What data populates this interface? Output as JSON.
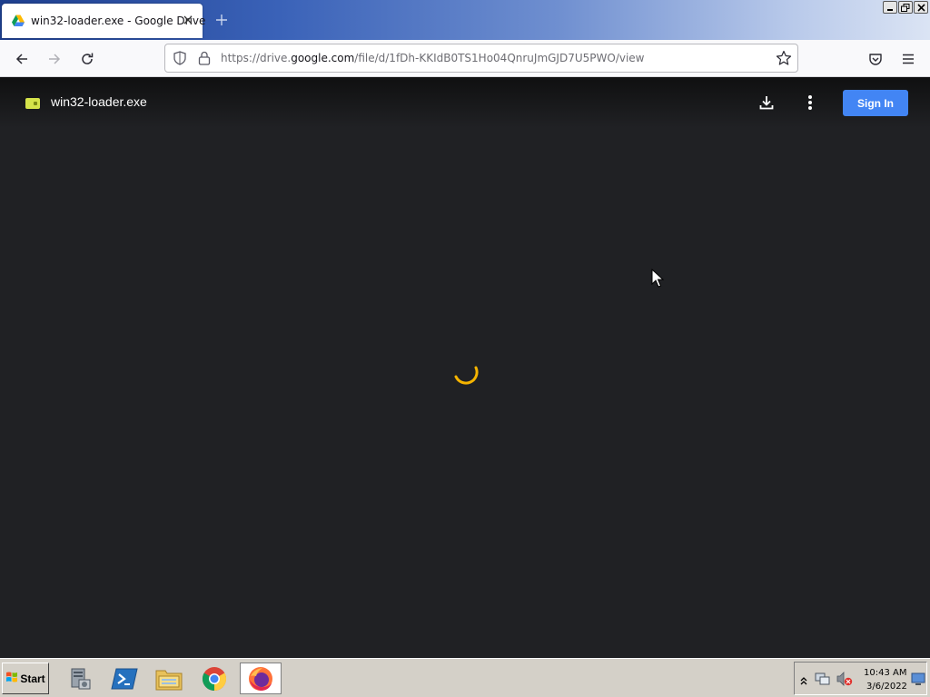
{
  "browser": {
    "tab": {
      "title": "win32-loader.exe - Google Drive"
    },
    "url": {
      "prefix": "https://drive.",
      "domain": "google.com",
      "path": "/file/d/1fDh-KKIdB0TS1Ho04QnruJmGJD7U5PWO/view"
    }
  },
  "viewer": {
    "file_name": "win32-loader.exe",
    "sign_in_label": "Sign In",
    "state": "loading"
  },
  "taskbar": {
    "start_label": "Start",
    "clock_time": "10:43 AM",
    "clock_date": "3/6/2022"
  },
  "colors": {
    "viewer_background": "#202124",
    "sign_in_button": "#4285f4",
    "spinner": "#f5b400",
    "file_icon": "#d5e34a"
  },
  "icons": [
    "google-drive-favicon-icon",
    "close-icon",
    "plus-icon",
    "back-arrow-icon",
    "forward-arrow-icon",
    "reload-icon",
    "shield-icon",
    "lock-icon",
    "star-icon",
    "pocket-icon",
    "hamburger-menu-icon",
    "download-icon",
    "more-vertical-icon",
    "loading-spinner",
    "windows-logo-icon",
    "server-manager-icon",
    "powershell-icon",
    "file-explorer-icon",
    "chrome-icon",
    "firefox-icon",
    "network-icon",
    "volume-muted-icon"
  ]
}
